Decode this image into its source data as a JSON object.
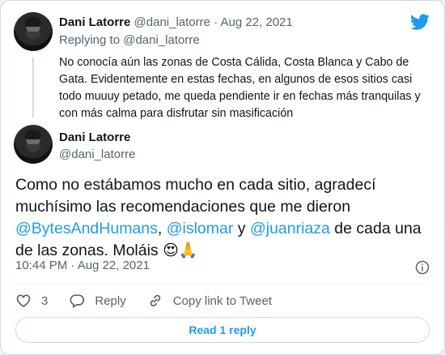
{
  "parent_tweet": {
    "author_name": "Dani Latorre",
    "author_handle": "@dani_latorre",
    "separator": "·",
    "date": "Aug 22, 2021",
    "replying_to_label": "Replying to",
    "replying_to_handle": "@dani_latorre",
    "text": "No conocía aún las zonas de Costa Cálida, Costa Blanca y Cabo de Gata. Evidentemente en estas fechas, en algunos de esos sitios casi todo muuuy petado, me queda pendiente ir en fechas más tranquilas y con más calma para disfrutar sin masificación"
  },
  "main_tweet": {
    "author_name": "Dani Latorre",
    "author_handle": "@dani_latorre",
    "text_part1": "Como no estábamos mucho en cada sitio, agradecí muchísimo las recomendaciones que me dieron ",
    "mention1": "@BytesAndHumans",
    "sep1": ", ",
    "mention2": "@islomar",
    "sep2": " y ",
    "mention3": "@juanriaza",
    "text_part2": " de cada una de las zonas. Moláis ",
    "emoji1": "😍",
    "emoji2": "🙏",
    "timestamp": "10:44 PM · Aug 22, 2021"
  },
  "actions": {
    "like_count": "3",
    "reply_label": "Reply",
    "copy_link_label": "Copy link to Tweet"
  },
  "read_replies_label": "Read 1 reply",
  "colors": {
    "accent": "#1d9bf0",
    "muted": "#536471",
    "text": "#0f1419",
    "border": "#cfd9de"
  }
}
